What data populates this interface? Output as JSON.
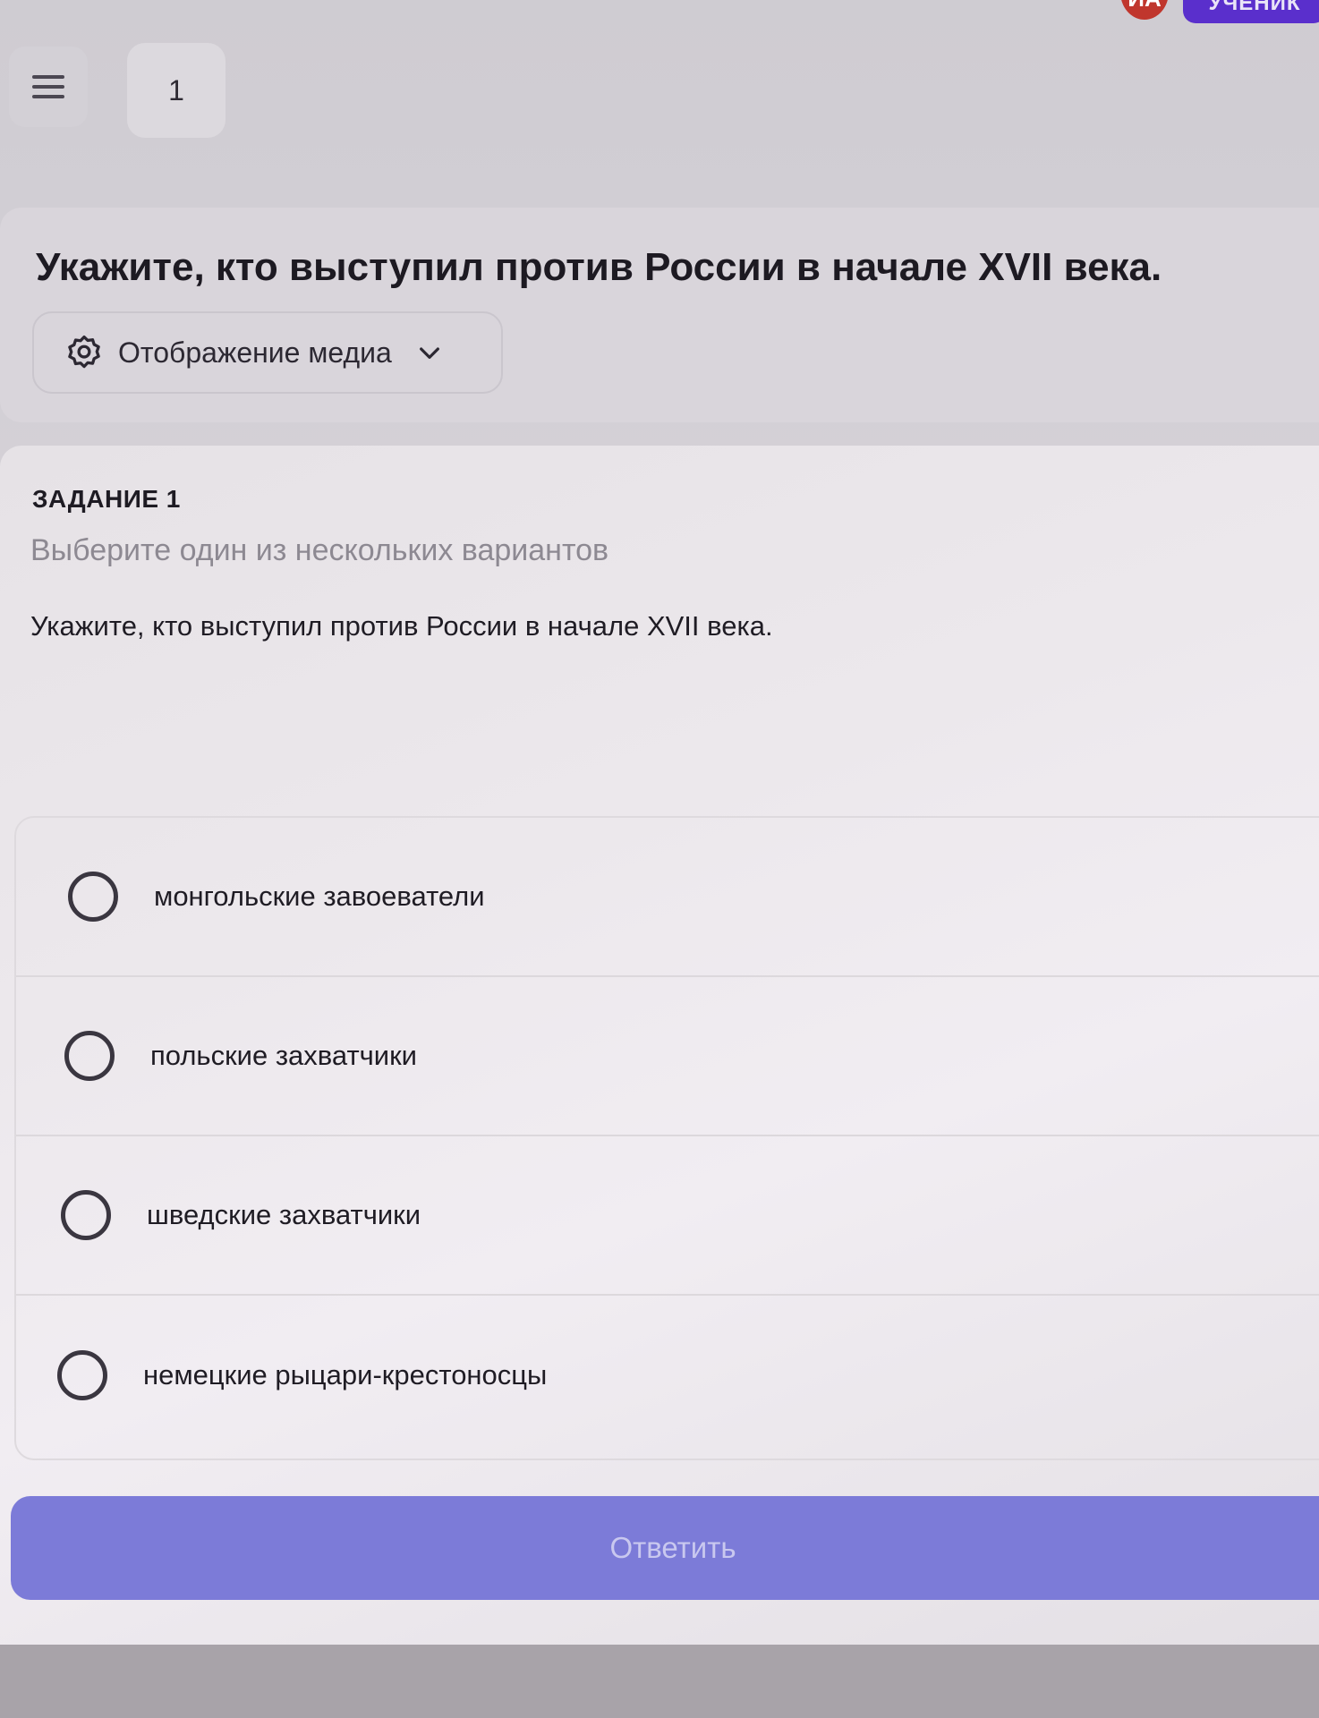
{
  "header": {
    "menu_icon": "menu-icon",
    "page_number": "1",
    "avatar_initials": "ИА",
    "role_badge": "УЧЕНИК"
  },
  "title_card": {
    "title": "Укажите, кто выступил против России в начале XVII века.",
    "media_toggle": {
      "icon": "gear-icon",
      "label": "Отображение медиа",
      "chevron": "chevron-down-icon"
    }
  },
  "task": {
    "number_label": "ЗАДАНИЕ 1",
    "hint": "Выберите один из нескольких вариантов",
    "question": "Укажите, кто выступил против России в начале XVII века.",
    "options": [
      {
        "label": "монгольские завоеватели",
        "selected": false
      },
      {
        "label": "польские захватчики",
        "selected": false
      },
      {
        "label": "шведские захватчики",
        "selected": false
      },
      {
        "label": "немецкие рыцари-крестоносцы",
        "selected": false
      }
    ]
  },
  "submit_label": "Ответить",
  "colors": {
    "accent": "#7c7bd8",
    "badge": "#5a2fcc",
    "avatar": "#c0362d"
  }
}
